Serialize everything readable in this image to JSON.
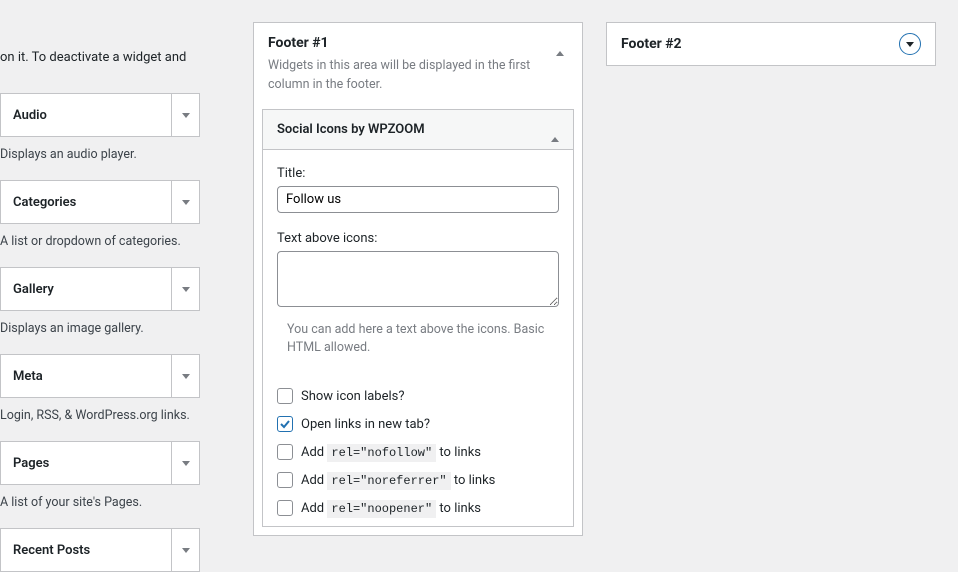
{
  "left": {
    "help": "on it. To deactivate a widget and",
    "widgets": [
      {
        "title": "Audio",
        "desc": "Displays an audio player."
      },
      {
        "title": "Categories",
        "desc": "A list or dropdown of categories."
      },
      {
        "title": "Gallery",
        "desc": "Displays an image gallery."
      },
      {
        "title": "Meta",
        "desc": "Login, RSS, & WordPress.org links."
      },
      {
        "title": "Pages",
        "desc": "A list of your site's Pages."
      },
      {
        "title": "Recent Posts",
        "desc": ""
      }
    ]
  },
  "footer1": {
    "title": "Footer #1",
    "sub": "Widgets in this area will be displayed in the first column in the footer.",
    "widget": {
      "title": "Social Icons by WPZOOM",
      "fields": {
        "title_label": "Title:",
        "title_value": "Follow us",
        "text_above_label": "Text above icons:",
        "text_above_value": "",
        "text_above_help": "You can add here a text above the icons. Basic HTML allowed."
      },
      "checks": {
        "show_labels": {
          "label": "Show icon labels?",
          "checked": false
        },
        "new_tab": {
          "label": "Open links in new tab?",
          "checked": true
        },
        "nofollow": {
          "prefix": "Add ",
          "code": "rel=\"nofollow\"",
          "suffix": " to links",
          "checked": false
        },
        "noreferrer": {
          "prefix": "Add ",
          "code": "rel=\"noreferrer\"",
          "suffix": " to links",
          "checked": false
        },
        "noopener": {
          "prefix": "Add ",
          "code": "rel=\"noopener\"",
          "suffix": " to links",
          "checked": false
        }
      }
    }
  },
  "footer2": {
    "title": "Footer #2"
  }
}
